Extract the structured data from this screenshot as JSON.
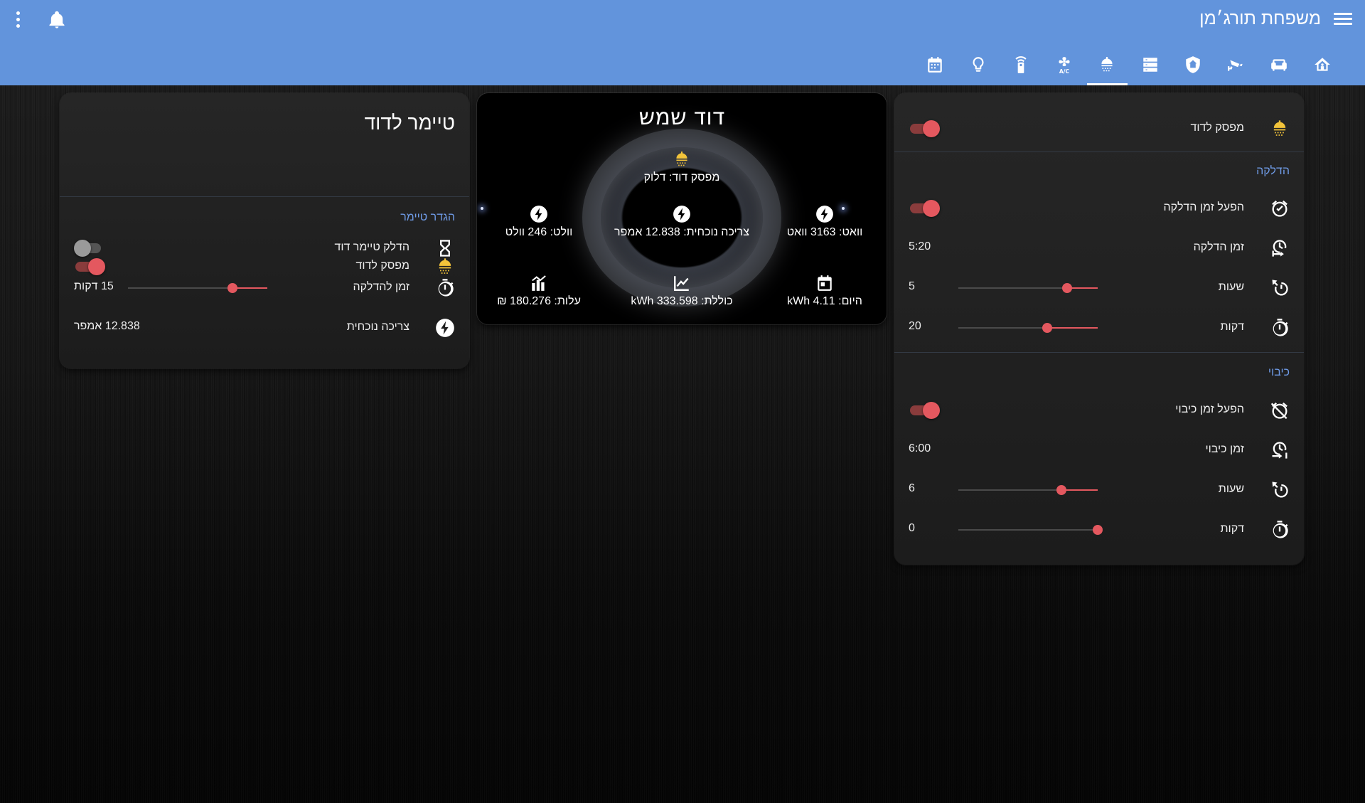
{
  "header": {
    "title": "משפחת תורג׳מן",
    "tabs": [
      {
        "name": "home-icon"
      },
      {
        "name": "sofa-icon"
      },
      {
        "name": "cctv-icon"
      },
      {
        "name": "shield-home-icon"
      },
      {
        "name": "server-icon"
      },
      {
        "name": "water-heater-icon",
        "active": true
      },
      {
        "name": "air-conditioner-icon"
      },
      {
        "name": "remote-icon"
      },
      {
        "name": "lightbulb-icon"
      },
      {
        "name": "calendar-icon"
      }
    ]
  },
  "timer_card": {
    "title": "טיימר לדוד",
    "switch_label": "מפסק לדוד",
    "switch_on": true,
    "section_label": "הגדר טיימר",
    "timer_toggle_label": "הדלק טיימר דוד",
    "timer_toggle_on": false,
    "duration_label": "זמן להדלקה",
    "duration_value": "15 דקות",
    "duration_fraction": 0.25,
    "current_label": "צריכה נוכחית",
    "current_value": "12.838 אמפר"
  },
  "solar_card": {
    "title": "דוד שמש",
    "switch_status": "מפסק דוד: דלוק",
    "watt": "וואט: 3163 וואט",
    "current": "צריכה נוכחית: 12.838 אמפר",
    "volt": "וולט: 246 וולט",
    "today": "היום: 4.11 kWh",
    "total": "כוללת: 333.598 kWh",
    "cost": "עלות: 180.276 ₪"
  },
  "schedule_card": {
    "switch_label": "מפסק לדוד",
    "switch_on": true,
    "on_section": "הדלקה",
    "on_enable_label": "הפעל זמן הדלקה",
    "on_enable": true,
    "on_time_label": "זמן הדלקה",
    "on_time_value": "5:20",
    "on_hours_label": "שעות",
    "on_hours_value": "5",
    "on_hours_fraction": 0.22,
    "on_minutes_label": "דקות",
    "on_minutes_value": "20",
    "on_minutes_fraction": 0.36,
    "off_section": "כיבוי",
    "off_enable_label": "הפעל זמן כיבוי",
    "off_enable": true,
    "off_time_label": "זמן כיבוי",
    "off_time_value": "6:00",
    "off_hours_label": "שעות",
    "off_hours_value": "6",
    "off_hours_fraction": 0.26,
    "off_minutes_label": "דקות",
    "off_minutes_value": "0",
    "off_minutes_fraction": 0.0
  },
  "colors": {
    "header": "#6294dc",
    "accent": "#e4585f",
    "section": "#6f9be6",
    "heater_icon": "#f2c33a"
  }
}
